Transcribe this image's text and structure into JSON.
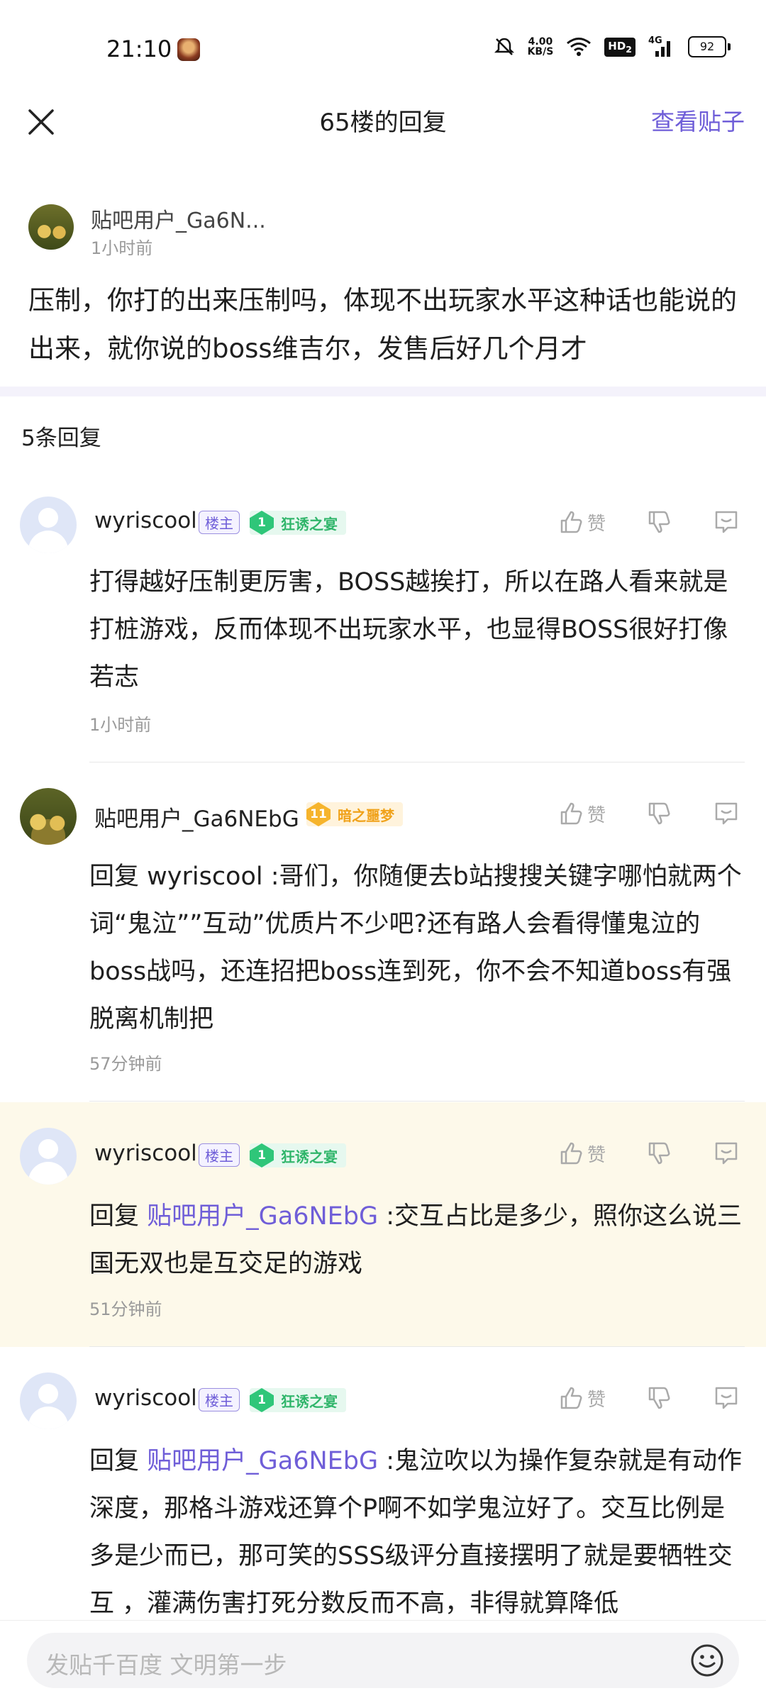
{
  "status_bar": {
    "time": "21:10",
    "speed_value": "4.00",
    "speed_unit": "KB/S",
    "hd": "HD",
    "hd_sub": "2",
    "network": "4G",
    "battery": "92"
  },
  "nav": {
    "title": "65楼的回复",
    "view_post": "查看贴子"
  },
  "op": {
    "username": "贴吧用户_Ga6N...",
    "time": "1小时前",
    "content": "压制，你打的出来压制吗，体现不出玩家水平这种话也能说的出来，就你说的boss维吉尔，发售后好几个月才"
  },
  "reply_count": "5条回复",
  "actions": {
    "like_label": "赞"
  },
  "comments": [
    {
      "username": "wyriscool",
      "op_badge": "楼主",
      "level": "1",
      "level_name": "狂诱之宴",
      "prefix": "",
      "mention": "",
      "text": "打得越好压制更厉害，BOSS越挨打，所以在路人看来就是打桩游戏，反而体现不出玩家水平，也显得BOSS很好打像若志",
      "time": "1小时前"
    },
    {
      "username": "贴吧用户_Ga6NEbG",
      "level": "11",
      "level_name": "暗之噩梦",
      "prefix": "",
      "mention": "",
      "text": "回复 wyriscool :哥们，你随便去b站搜搜关键字哪怕就两个词“鬼泣””互动”优质片不少吧?还有路人会看得懂鬼泣的boss战吗，还连招把boss连到死，你不会不知道boss有强脱离机制把",
      "time": "57分钟前"
    },
    {
      "username": "wyriscool",
      "op_badge": "楼主",
      "level": "1",
      "level_name": "狂诱之宴",
      "prefix": "回复 ",
      "mention": "贴吧用户_Ga6NEbG",
      "text": " :交互占比是多少，照你这么说三国无双也是互交足的游戏",
      "time": "51分钟前"
    },
    {
      "username": "wyriscool",
      "op_badge": "楼主",
      "level": "1",
      "level_name": "狂诱之宴",
      "prefix": "回复 ",
      "mention": "贴吧用户_Ga6NEbG",
      "text": " :鬼泣吹以为操作复杂就是有动作深度，那格斗游戏还算个P啊不如学鬼泣好了。交互比例是多是少而已，那可笑的SSS级评分直接摆明了就是要牺牲交互 ，灌满伤害打死分数反而不高，非得就算降低",
      "time": ""
    }
  ],
  "input": {
    "placeholder": "发贴千百度 文明第一步"
  }
}
